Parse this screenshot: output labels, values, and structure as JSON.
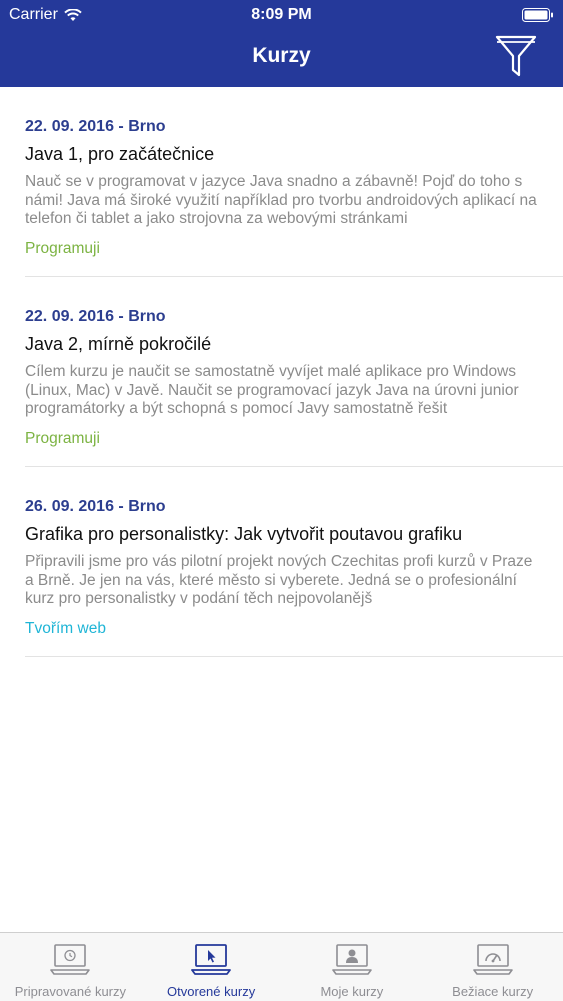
{
  "status_bar": {
    "carrier": "Carrier",
    "time": "8:09 PM"
  },
  "header": {
    "title": "Kurzy"
  },
  "courses": [
    {
      "date": "22. 09. 2016 - Brno",
      "title": "Java 1, pro začátečnice",
      "description": "Nauč se v programovat v jazyce Java snadno a zábavně! Pojď do toho s námi! Java má široké využití například pro tvorbu androidových aplikací na telefon či tablet a jako strojovna za webovými stránkami",
      "tag": "Programuji"
    },
    {
      "date": "22. 09. 2016 - Brno",
      "title": "Java 2, mírně pokročilé",
      "description": "Cílem kurzu je naučit se samostatně vyvíjet malé aplikace pro Windows (Linux, Mac) v Javě. Naučit se programovací jazyk Java na úrovni junior programátorky a být schopná s pomocí Javy samostatně řešit",
      "tag": "Programuji"
    },
    {
      "date": "26. 09. 2016 - Brno",
      "title": "Grafika pro personalistky: Jak vytvořit poutavou grafiku",
      "description": "Připravili jsme pro vás pilotní projekt nových Czechitas profi kurzů v Praze a Brně. Je jen na vás, které město si vyberete. Jedná se o profesionální kurz pro personalistky v podání těch nejpovolanějš",
      "tag": "Tvořím web"
    }
  ],
  "tabs": [
    {
      "label": "Pripravované kurzy",
      "icon": "laptop-clock-icon"
    },
    {
      "label": "Otvorené kurzy",
      "icon": "laptop-cursor-icon",
      "active": true
    },
    {
      "label": "Moje kurzy",
      "icon": "laptop-person-icon"
    },
    {
      "label": "Bežiace kurzy",
      "icon": "laptop-gauge-icon"
    }
  ],
  "colors": {
    "header": "#25399a",
    "date": "#2c3e8f",
    "tag_programuji": "#7cb342",
    "tag_web": "#1fb5d6",
    "tab_inactive": "#8e8e93"
  }
}
